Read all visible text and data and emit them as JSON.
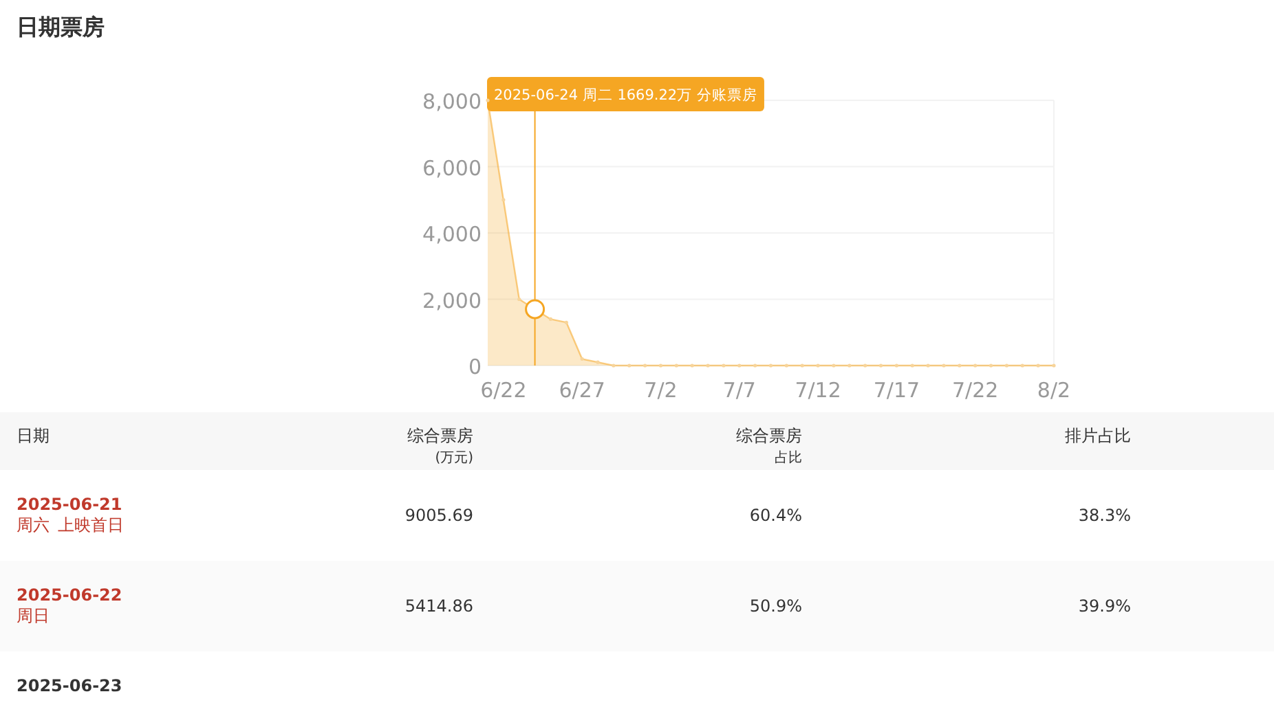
{
  "title": "日期票房",
  "chart": {
    "chart_data": {
      "type": "area",
      "categories": [
        null,
        "6/22",
        null,
        null,
        null,
        null,
        "6/27",
        null,
        null,
        null,
        null,
        "7/2",
        null,
        null,
        null,
        null,
        "7/7",
        null,
        null,
        null,
        null,
        "7/12",
        null,
        null,
        null,
        null,
        "7/17",
        null,
        null,
        null,
        null,
        "7/22",
        null,
        null,
        null,
        null,
        "8/2"
      ],
      "series": [
        {
          "color": "#f5a623",
          "values": [
            8000,
            5000,
            2000,
            1700,
            1400,
            1300,
            200,
            100,
            0,
            0,
            0,
            0,
            0,
            0,
            0,
            0,
            0,
            0,
            0,
            0,
            0,
            0,
            0,
            0,
            0,
            0,
            0,
            0,
            0,
            0,
            0,
            0,
            0,
            0,
            0,
            0,
            0
          ]
        }
      ],
      "ylim": [
        0,
        8000
      ],
      "grid": true,
      "yticks": [
        {
          "value": 0,
          "label": "0"
        },
        {
          "value": 2000,
          "label": "2,000"
        },
        {
          "value": 4000,
          "label": "4,000"
        },
        {
          "value": 6000,
          "label": "6,000"
        },
        {
          "value": 8000,
          "label": "8,000"
        }
      ],
      "annotations": [
        "2025-06-24 周二 1669.22万 分账票房"
      ]
    },
    "points": [
      {
        "selected": false
      },
      {
        "selected": false
      },
      {
        "selected": false
      },
      {
        "selected": true
      },
      {
        "selected": false
      },
      {
        "selected": false
      },
      {
        "selected": false
      },
      {
        "selected": false
      },
      {
        "selected": false
      },
      {
        "selected": false
      },
      {
        "selected": false
      },
      {
        "selected": false
      },
      {
        "selected": false
      },
      {
        "selected": false
      },
      {
        "selected": false
      },
      {
        "selected": false
      },
      {
        "selected": false
      },
      {
        "selected": false
      },
      {
        "selected": false
      },
      {
        "selected": false
      },
      {
        "selected": false
      },
      {
        "selected": false
      },
      {
        "selected": false
      },
      {
        "selected": false
      },
      {
        "selected": false
      },
      {
        "selected": false
      },
      {
        "selected": false
      },
      {
        "selected": false
      },
      {
        "selected": false
      },
      {
        "selected": false
      },
      {
        "selected": false
      },
      {
        "selected": false
      },
      {
        "selected": false
      },
      {
        "selected": false
      },
      {
        "selected": false
      },
      {
        "selected": false
      },
      {
        "selected": false
      }
    ]
  },
  "table": {
    "columns": [
      {
        "label": "日期"
      },
      {
        "label": "综合票房",
        "unit": "(万元)"
      },
      {
        "label": "综合票房",
        "unit": "占比"
      },
      {
        "label": "排片占比"
      }
    ],
    "rows": [
      {
        "date": "2025-06-21",
        "weekday": "周六",
        "note": "上映首日",
        "highlighted": true,
        "box_office": "9005.69",
        "box_share": "60.4%",
        "screening_share": "38.3%"
      },
      {
        "date": "2025-06-22",
        "weekday": "周日",
        "highlighted": true,
        "box_office": "5414.86",
        "box_share": "50.9%",
        "screening_share": "39.9%"
      },
      {
        "date": "2025-06-23",
        "highlighted": false
      }
    ]
  }
}
